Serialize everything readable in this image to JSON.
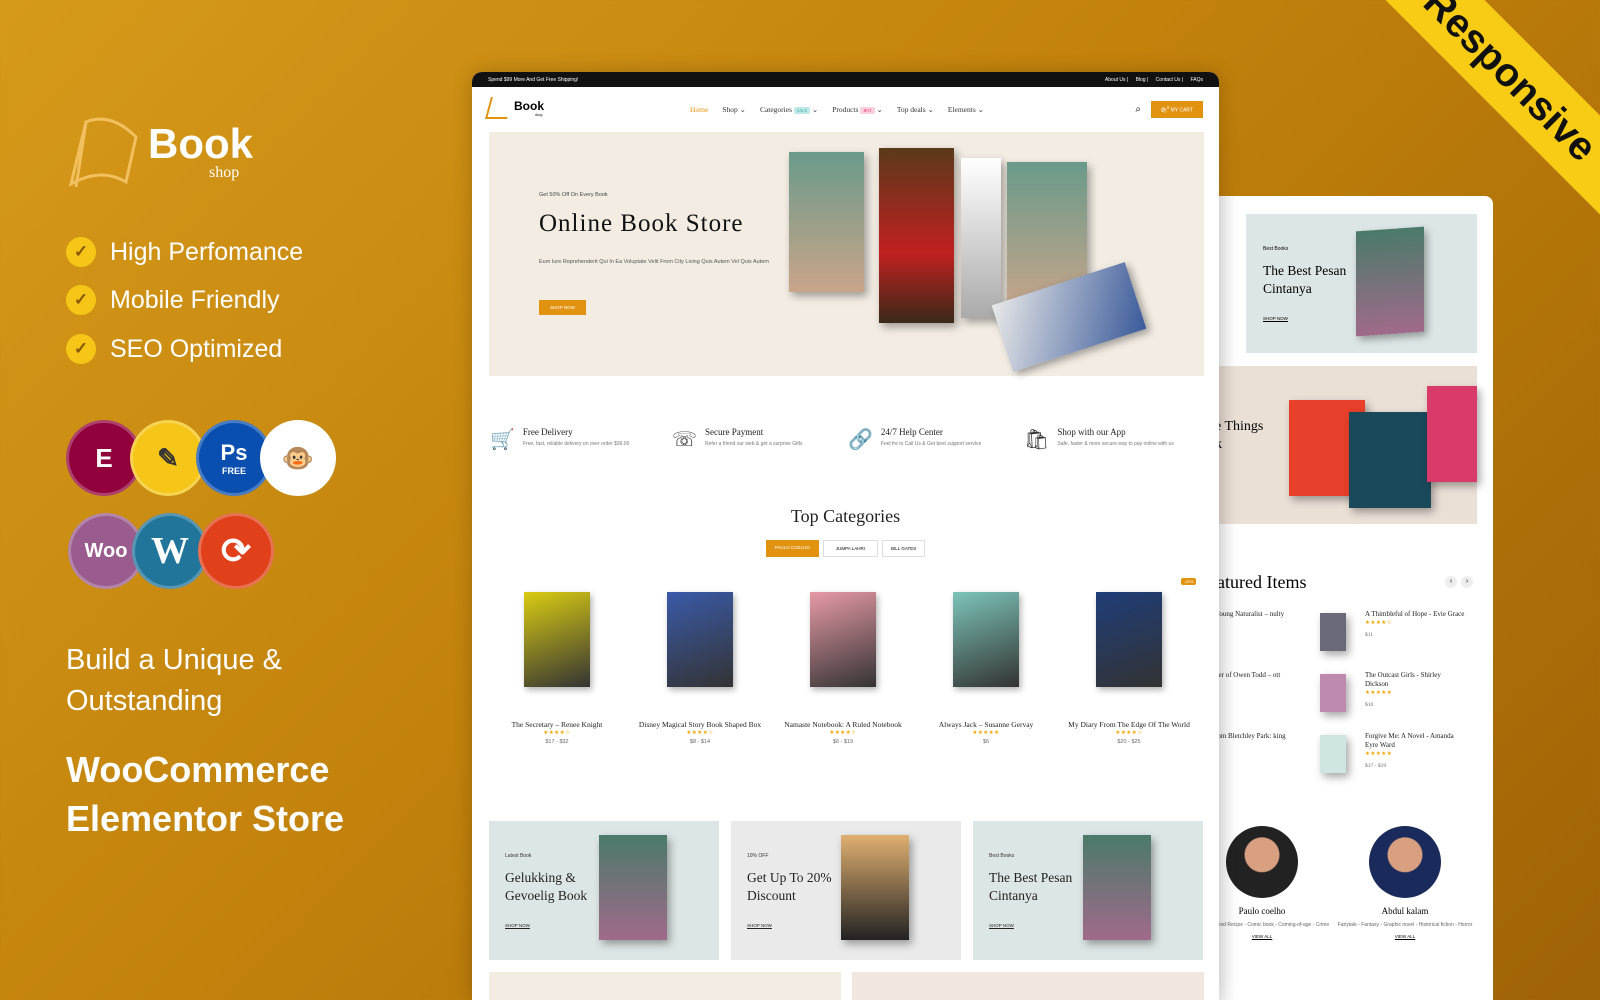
{
  "promo": {
    "logo": {
      "name": "Book",
      "sub": "shop"
    },
    "features": [
      "High Perfomance",
      "Mobile Friendly",
      "SEO Optimized"
    ],
    "plugin_icons": [
      "elementor-icon",
      "notes-icon",
      "photoshop-icon",
      "mailchimp-icon",
      "woocommerce-icon",
      "wordpress-icon",
      "sync-icon"
    ],
    "ps_label": "Ps",
    "ps_free": "FREE",
    "woo_label": "Woo",
    "tagline1": [
      "Build a Unique &",
      "Outstanding"
    ],
    "tagline2": [
      "WooCommerce",
      "Elementor Store"
    ],
    "ribbon": "Responsive",
    "colors": {
      "background": "#c2820c",
      "accent": "#f8cc14",
      "brand": "#e1920f"
    }
  },
  "site": {
    "topbar": {
      "promo": "Spend $99 More And Get Free Shipping!",
      "links": [
        "About Us",
        "Blog",
        "Contact Us",
        "FAQs"
      ]
    },
    "logo": {
      "name": "Book",
      "sub": "shop"
    },
    "nav": [
      {
        "label": "Home"
      },
      {
        "label": "Shop"
      },
      {
        "label": "Categories",
        "pill": "SALE"
      },
      {
        "label": "Products",
        "pill": "HOT"
      },
      {
        "label": "Top deals"
      },
      {
        "label": "Elements"
      }
    ],
    "cart": {
      "label": "MY CART",
      "count": "0"
    },
    "hero": {
      "kicker": "Get 50% Off On Every Book",
      "title": "Online Book Store",
      "text": "Eum Iure Reprehenderit Qui In Ea Voluptate Velit From City Living Quis Autem Vel Quis Autem",
      "button": "SHOP NOW"
    },
    "services": [
      {
        "icon": "cart-gift-icon",
        "title": "Free Delivery",
        "text": "Free, fast, reliable delivery on over order $99.00"
      },
      {
        "icon": "phone-icon",
        "title": "Secure Payment",
        "text": "Refer a friend our web & get a surprise Gifts"
      },
      {
        "icon": "link-icon",
        "title": "24/7 Help Center",
        "text": "Feel fre to Call Us & Get best support service"
      },
      {
        "icon": "shopping-bag-icon",
        "title": "Shop with our App",
        "text": "Safe, faster & more secure way to pay online with us"
      }
    ],
    "categories": {
      "title": "Top Categories",
      "tabs": [
        "PAULO COELHO",
        "JUMPA LAHRI",
        "BILL GATES"
      ]
    },
    "products": [
      {
        "name": "The Secretary – Renee Knight",
        "rating": 4,
        "price": "$17 - $32",
        "cover": "#d9cc12"
      },
      {
        "name": "Disney Magical Story Book Shaped Box",
        "rating": 4,
        "price": "$8 - $14",
        "cover": "#3a5aa8"
      },
      {
        "name": "Namaste Notebook: A Ruled Notebook",
        "rating": 4,
        "price": "$6 - $19",
        "cover": "#e79aa6"
      },
      {
        "name": "Always Jack – Susanne Gervay",
        "rating": 5,
        "price": "$6",
        "cover": "#7cc4b8"
      },
      {
        "name": "My Diary From The Edge Of The World",
        "rating": 4,
        "price": "$20 - $25",
        "cover": "#1f3d78",
        "badge": "-20%"
      }
    ],
    "banners": [
      {
        "kicker": "Latest Book",
        "title": "Gelukking & Gevoelig Book",
        "link": "SHOP NOW"
      },
      {
        "kicker": "10% OFF",
        "title": "Get Up To 20% Discount",
        "link": "SHOP NOW"
      },
      {
        "kicker": "Best Books",
        "title": "The Best Pesan Cintanya",
        "link": "SHOP NOW"
      }
    ]
  },
  "second": {
    "banner": {
      "kicker": "Best Books",
      "title": "The Best Pesan Cintanya",
      "link": "SHOP NOW"
    },
    "banner2_partial": "e Things",
    "banner2_partial2": "k",
    "featured": {
      "title": "atured Items",
      "left": [
        "Young Naturalist – nulty",
        "ner of Owen Todd – ott",
        "rom Bletchley Park: king"
      ],
      "right": [
        {
          "name": "A Thimbleful of Hope - Evie Grace",
          "rating": 4,
          "price": "$11"
        },
        {
          "name": "The Outcast Girls - Shirley Dickson",
          "rating": 5,
          "price": "$10"
        },
        {
          "name": "Forgive Me: A Novel - Amanda Eyre Ward",
          "rating": 5,
          "price": "$17 - $19"
        }
      ]
    },
    "authors": [
      {
        "name": "Paulo coelho",
        "genres": "graphy - Food Recipe - Comic book - Coming-of-age - Crime",
        "link": "VIEW ALL"
      },
      {
        "name": "Abdul kalam",
        "genres": "Fairytale - Fantasy - Graphic novel - Historical fiction - Horror",
        "link": "VIEW ALL"
      }
    ]
  }
}
